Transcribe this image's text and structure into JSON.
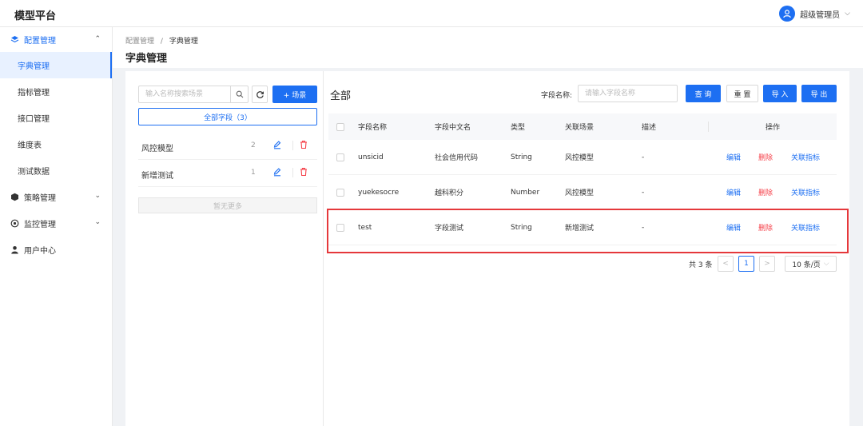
{
  "app": {
    "title": "模型平台"
  },
  "user": {
    "name": "超级管理员"
  },
  "sidebar": {
    "groups": [
      {
        "label": "配置管理",
        "icon": "layers-icon",
        "expanded": true
      },
      {
        "label": "策略管理",
        "icon": "cube-icon",
        "expanded": false
      },
      {
        "label": "监控管理",
        "icon": "monitor-icon",
        "expanded": false
      },
      {
        "label": "用户中心",
        "icon": "user-icon"
      }
    ],
    "items": [
      {
        "label": "字典管理",
        "active": true
      },
      {
        "label": "指标管理"
      },
      {
        "label": "接口管理"
      },
      {
        "label": "维度表"
      },
      {
        "label": "测试数据"
      }
    ]
  },
  "breadcrumb": {
    "parent": "配置管理",
    "separator": "/",
    "current": "字典管理"
  },
  "page": {
    "title": "字典管理"
  },
  "left": {
    "search_placeholder": "输入名称搜索场景",
    "add_button": "+ 场景",
    "all_fields": "全部字段（3）",
    "scenes": [
      {
        "name": "风控模型",
        "count": "2"
      },
      {
        "name": "新增测试",
        "count": "1"
      }
    ],
    "no_more": "暂无更多"
  },
  "right": {
    "title": "全部",
    "filter_label": "字段名称:",
    "filter_placeholder": "请输入字段名称",
    "buttons": {
      "query": "查 询",
      "reset": "重 置",
      "import": "导 入",
      "export": "导 出"
    }
  },
  "table": {
    "headers": [
      "字段名称",
      "字段中文名",
      "类型",
      "关联场景",
      "描述",
      "操作"
    ],
    "rows": [
      {
        "name": "unsicid",
        "cn_name": "社会信用代码",
        "type": "String",
        "scene": "风控模型",
        "desc": "-"
      },
      {
        "name": "yuekesocre",
        "cn_name": "越科积分",
        "type": "Number",
        "scene": "风控模型",
        "desc": "-"
      },
      {
        "name": "test",
        "cn_name": "字段测试",
        "type": "String",
        "scene": "新增测试",
        "desc": "-"
      }
    ],
    "actions": {
      "edit": "编辑",
      "delete": "删除",
      "link": "关联指标"
    }
  },
  "pagination": {
    "total": "共 3 条",
    "current": "1",
    "page_size": "10 条/页"
  },
  "colors": {
    "primary": "#1d6ff2",
    "danger": "#f5424b",
    "highlight": "#e5383b"
  }
}
